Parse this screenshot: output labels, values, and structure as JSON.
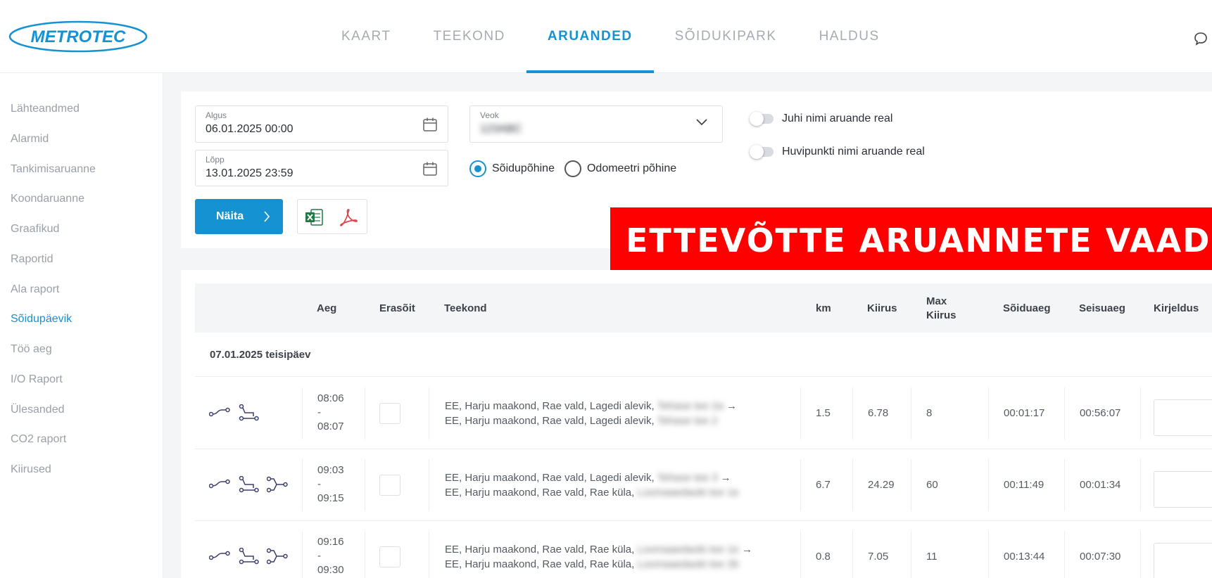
{
  "app": {
    "logo_text": "METROTEC"
  },
  "nav": [
    {
      "label": "KAART",
      "active": false
    },
    {
      "label": "TEEKOND",
      "active": false
    },
    {
      "label": "ARUANDED",
      "active": true
    },
    {
      "label": "SÕIDUKIPARK",
      "active": false
    },
    {
      "label": "HALDUS",
      "active": false
    }
  ],
  "sidebar": {
    "items": [
      {
        "label": "Lähteandmed"
      },
      {
        "label": "Alarmid"
      },
      {
        "label": "Tankimisaruanne"
      },
      {
        "label": "Koondaruanne"
      },
      {
        "label": "Graafikud"
      },
      {
        "label": "Raportid"
      },
      {
        "label": "Ala raport"
      },
      {
        "label": "Sõidupäevik",
        "active": true
      },
      {
        "label": "Töö aeg"
      },
      {
        "label": "I/O Raport"
      },
      {
        "label": "Ülesanded"
      },
      {
        "label": "CO2 raport"
      },
      {
        "label": "Kiirused"
      }
    ]
  },
  "filters": {
    "start": {
      "label": "Algus",
      "value": "06.01.2025 00:00"
    },
    "end": {
      "label": "Lõpp",
      "value": "13.01.2025 23:59"
    },
    "vehicle": {
      "label": "Veok",
      "value": "123ABC"
    },
    "mode_options": [
      {
        "label": "Sõidupõhine",
        "selected": true
      },
      {
        "label": "Odomeetri põhine",
        "selected": false
      }
    ],
    "toggles": [
      {
        "label": "Juhi nimi aruande real",
        "on": false
      },
      {
        "label": "Huvipunkti nimi aruande real",
        "on": false
      }
    ],
    "show_button": "Näita"
  },
  "banner": {
    "text": "ETTEVÕTTE ARUANNETE VAADE",
    "color": "#ff0000"
  },
  "table": {
    "headers": {
      "aeg": "Aeg",
      "erasoit": "Erasõit",
      "teekond": "Teekond",
      "km": "km",
      "kiirus": "Kiirus",
      "max_kiirus_1": "Max",
      "max_kiirus_2": "Kiirus",
      "soiduaeg": "Sõiduaeg",
      "seisuaeg": "Seisuaeg",
      "kirjeldus": "Kirjeldus"
    },
    "day_label": "07.01.2025 teisipäev",
    "rows": [
      {
        "time_start": "08:06",
        "time_sep": "-",
        "time_end": "08:07",
        "from": "EE, Harju maakond, Rae vald, Lagedi alevik,",
        "from_blur": "Tehase tee 2a",
        "to": "EE, Harju maakond, Rae vald, Lagedi alevik,",
        "to_blur": "Tehase tee 2",
        "arrow": "→",
        "km": "1.5",
        "speed": "6.78",
        "max_speed": "8",
        "drive_time": "00:01:17",
        "stop_time": "00:56:07"
      },
      {
        "time_start": "09:03",
        "time_sep": "-",
        "time_end": "09:15",
        "from": "EE, Harju maakond, Rae vald, Lagedi alevik,",
        "from_blur": "Tehase tee 3",
        "to": "EE, Harju maakond, Rae vald, Rae küla,",
        "to_blur": "Loomaaedaoki tee 1e",
        "arrow": "→",
        "km": "6.7",
        "speed": "24.29",
        "max_speed": "60",
        "drive_time": "00:11:49",
        "stop_time": "00:01:34"
      },
      {
        "time_start": "09:16",
        "time_sep": "-",
        "time_end": "09:30",
        "from": "EE, Harju maakond, Rae vald, Rae küla,",
        "from_blur": "Loomaaedaoki tee 1e",
        "to": "EE, Harju maakond, Rae vald, Rae küla,",
        "to_blur": "Loomaaedaoki tee 2b",
        "arrow": "→",
        "km": "0.8",
        "speed": "7.05",
        "max_speed": "11",
        "drive_time": "00:13:44",
        "stop_time": "00:07:30"
      }
    ]
  },
  "colors": {
    "accent": "#1592d2",
    "excel": "#1d7a45",
    "pdf": "#e1434b"
  }
}
